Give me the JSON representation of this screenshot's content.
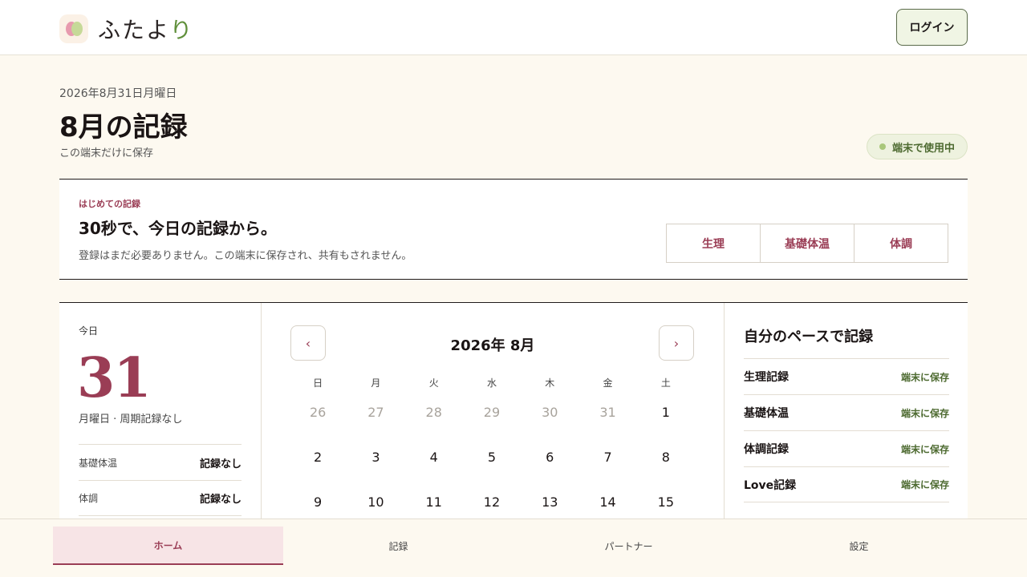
{
  "header": {
    "logo_icon": "futayori-logo-icon",
    "logo_text_main": "ふたよ",
    "logo_text_accent": "り",
    "login_label": "ログイン"
  },
  "page": {
    "date": "2026年8月31日月曜日",
    "title": "8月の記録",
    "subtitle": "この端末だけに保存",
    "device_badge": "端末で使用中"
  },
  "onboarding": {
    "kicker": "はじめての記録",
    "title": "30秒で、今日の記録から。",
    "description": "登録はまだ必要ありません。この端末に保存され、共有もされません。",
    "buttons": [
      "生理",
      "基礎体温",
      "体調"
    ]
  },
  "today": {
    "label": "今日",
    "day": "31",
    "sub": "月曜日 · 周期記録なし",
    "rows": [
      {
        "key": "基礎体温",
        "value": "記録なし"
      },
      {
        "key": "体調",
        "value": "記録なし"
      }
    ]
  },
  "calendar": {
    "title": "2026年 8月",
    "prev_label": "‹",
    "next_label": "›",
    "weekdays": [
      "日",
      "月",
      "火",
      "水",
      "木",
      "金",
      "土"
    ],
    "weeks": [
      [
        "26",
        "27",
        "28",
        "29",
        "30",
        "31",
        "1"
      ],
      [
        "2",
        "3",
        "4",
        "5",
        "6",
        "7",
        "8"
      ],
      [
        "9",
        "10",
        "11",
        "12",
        "13",
        "14",
        "15"
      ]
    ]
  },
  "side": {
    "title": "自分のペースで記録",
    "rows": [
      {
        "key": "生理記録",
        "value": "端末に保存"
      },
      {
        "key": "基礎体温",
        "value": "端末に保存"
      },
      {
        "key": "体調記録",
        "value": "端末に保存"
      },
      {
        "key": "Love記録",
        "value": "端末に保存"
      }
    ]
  },
  "tabs": [
    "ホーム",
    "記録",
    "パートナー",
    "設定"
  ],
  "colors": {
    "accent": "#9a3d55",
    "green": "#4d6a30",
    "background": "#fdf9f0"
  }
}
